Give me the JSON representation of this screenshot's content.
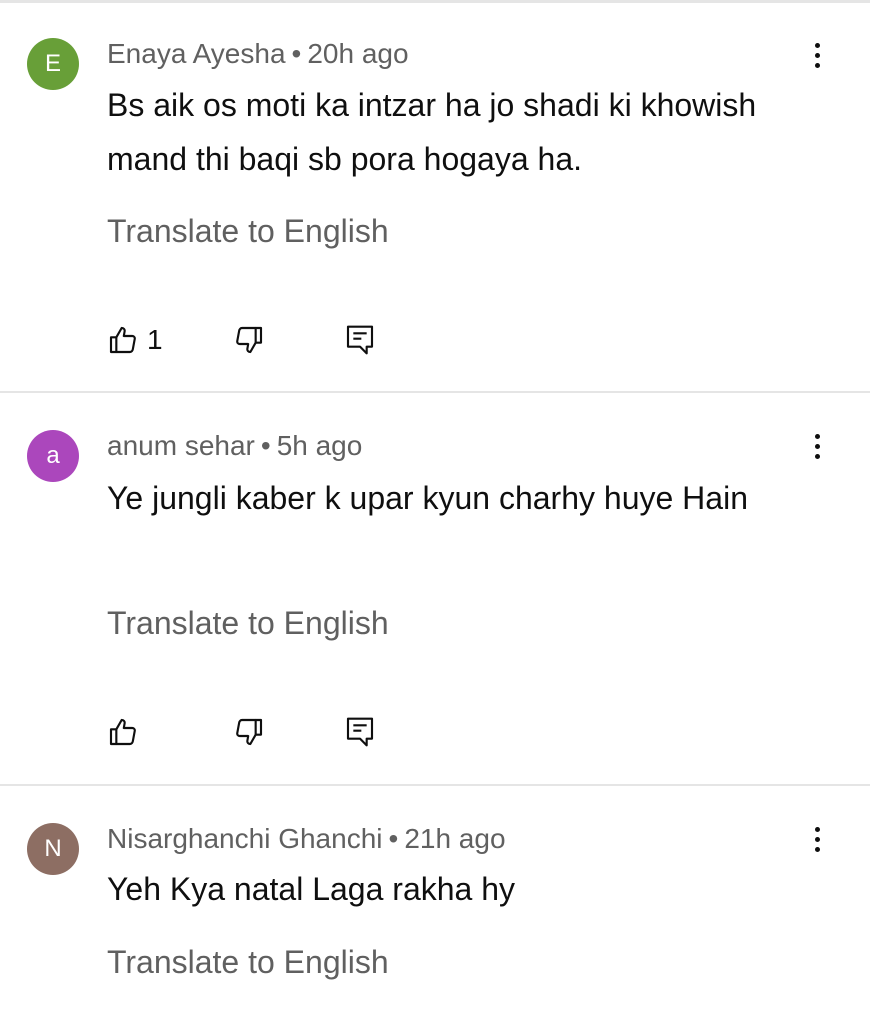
{
  "comments": [
    {
      "avatar_letter": "E",
      "avatar_color": "#689f38",
      "author": "Enaya Ayesha",
      "time": "20h ago",
      "text": "Bs aik os moti ka intzar ha jo shadi ki khowish mand thi baqi sb pora hogaya ha.",
      "translate_label": "Translate to English",
      "likes": "1"
    },
    {
      "avatar_letter": "a",
      "avatar_color": "#ab47bc",
      "author": "anum sehar",
      "time": "5h ago",
      "text": "Ye jungli kaber k upar kyun charhy huye Hain",
      "translate_label": "Translate to English",
      "likes": ""
    },
    {
      "avatar_letter": "N",
      "avatar_color": "#8d6e63",
      "author": "Nisarghanchi Ghanchi",
      "time": "21h ago",
      "text": "Yeh Kya natal Laga rakha hy",
      "translate_label": "Translate to English"
    }
  ],
  "separator": "•",
  "icons": {
    "like": "thumbs-up-icon",
    "dislike": "thumbs-down-icon",
    "reply": "reply-comment-icon",
    "more": "more-vert-icon"
  }
}
